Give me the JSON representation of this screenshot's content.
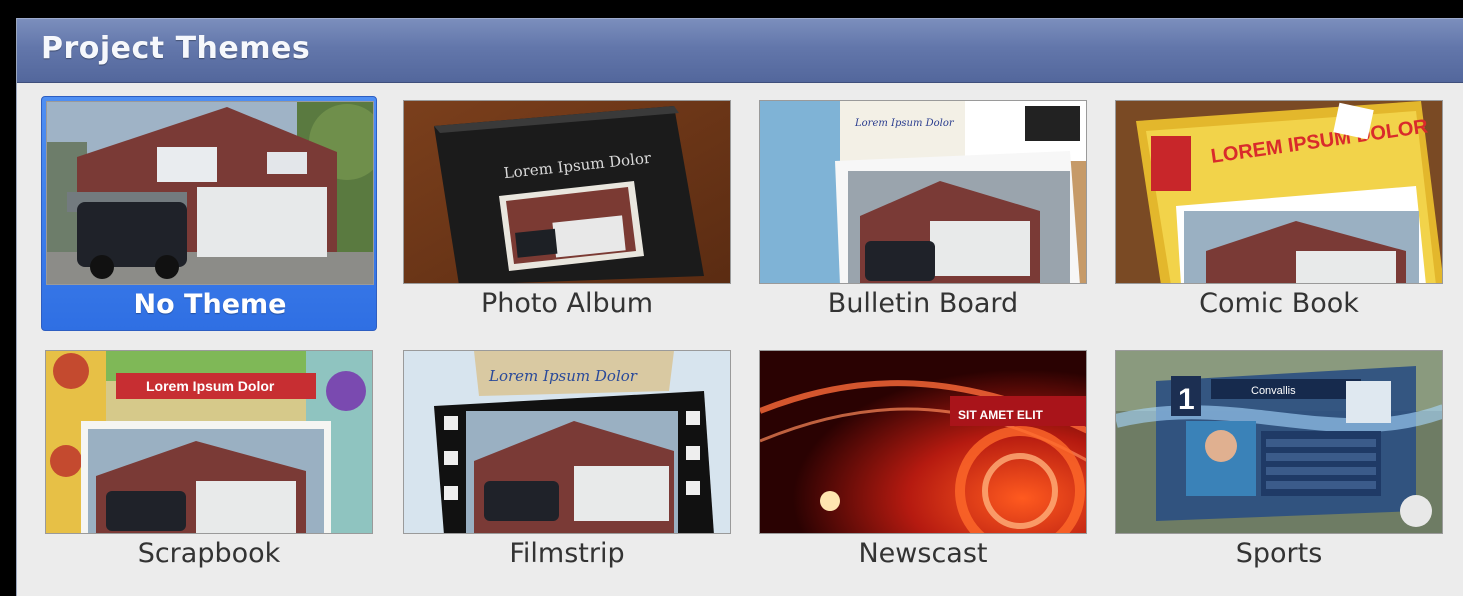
{
  "panel": {
    "title": "Project Themes"
  },
  "themes": [
    {
      "label": "No Theme",
      "selected": true
    },
    {
      "label": "Photo Album",
      "overlay_text": "Lorem Ipsum Dolor"
    },
    {
      "label": "Bulletin Board",
      "overlay_text": "Lorem Ipsum Dolor"
    },
    {
      "label": "Comic Book",
      "overlay_text": "LOREM IPSUM DOLOR"
    },
    {
      "label": "Scrapbook",
      "overlay_text": "Lorem Ipsum Dolor"
    },
    {
      "label": "Filmstrip",
      "overlay_text": "Lorem Ipsum Dolor"
    },
    {
      "label": "Newscast",
      "overlay_text": "SIT AMET ELIT"
    },
    {
      "label": "Sports",
      "overlay_text": "Convallis",
      "overlay_number": "1"
    }
  ],
  "colors": {
    "selection": "#3a7ae8",
    "titlebar": "#6377ab",
    "panel_bg": "#ececec"
  }
}
